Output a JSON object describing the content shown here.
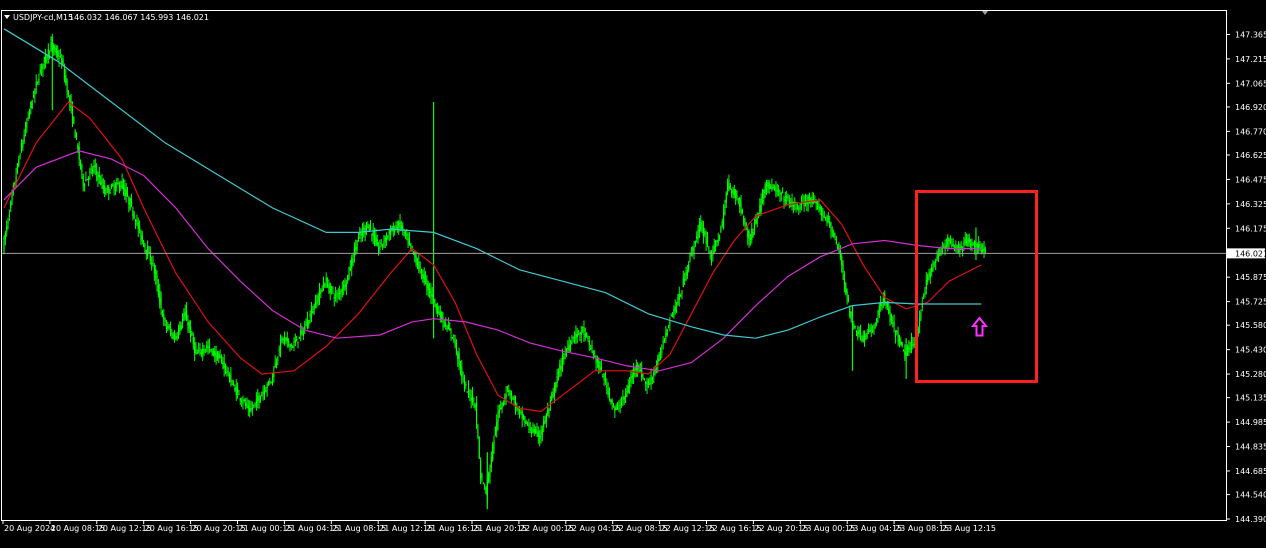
{
  "header": {
    "symbol": "USDJPY-cd,M15",
    "ohlc": "146.032 146.067 145.993 146.021"
  },
  "colors": {
    "background": "#000000",
    "frame": "#ffffff",
    "candle": "#00ff00",
    "ma_fast": "#e01010",
    "ma_medium": "#d030d0",
    "ma_slow": "#40c8d0",
    "price_line": "#a0a0a0",
    "highlight_box": "#ff2020",
    "arrow": "#ff30ff"
  },
  "chart_data": {
    "type": "line",
    "ylim": [
      144.39,
      147.46
    ],
    "current_price": 146.021,
    "current_price_label": "146.021",
    "y_ticks": [
      {
        "value": 147.365,
        "label": "147.365"
      },
      {
        "value": 147.215,
        "label": "147.215"
      },
      {
        "value": 147.065,
        "label": "147.065"
      },
      {
        "value": 146.92,
        "label": "146.920"
      },
      {
        "value": 146.77,
        "label": "146.770"
      },
      {
        "value": 146.625,
        "label": "146.625"
      },
      {
        "value": 146.475,
        "label": "146.475"
      },
      {
        "value": 146.325,
        "label": "146.325"
      },
      {
        "value": 146.175,
        "label": "146.175"
      },
      {
        "value": 145.875,
        "label": "145.875"
      },
      {
        "value": 145.725,
        "label": "145.725"
      },
      {
        "value": 145.58,
        "label": "145.580"
      },
      {
        "value": 145.43,
        "label": "145.430"
      },
      {
        "value": 145.28,
        "label": "145.280"
      },
      {
        "value": 145.135,
        "label": "145.135"
      },
      {
        "value": 144.985,
        "label": "144.985"
      },
      {
        "value": 144.835,
        "label": "144.835"
      },
      {
        "value": 144.685,
        "label": "144.685"
      },
      {
        "value": 144.54,
        "label": "144.540"
      },
      {
        "value": 144.39,
        "label": "144.390"
      }
    ],
    "x_labels": [
      "20 Aug 2024",
      "20 Aug 08:15",
      "20 Aug 12:15",
      "20 Aug 16:15",
      "20 Aug 20:15",
      "21 Aug 00:15",
      "21 Aug 04:15",
      "21 Aug 08:15",
      "21 Aug 12:15",
      "21 Aug 16:15",
      "21 Aug 20:15",
      "22 Aug 00:15",
      "22 Aug 04:15",
      "22 Aug 08:15",
      "22 Aug 12:15",
      "22 Aug 16:15",
      "22 Aug 20:15",
      "23 Aug 00:15",
      "23 Aug 04:15",
      "23 Aug 08:15",
      "23 Aug 12:15"
    ],
    "price_path": [
      [
        0,
        146.05
      ],
      [
        3,
        146.6
      ],
      [
        5,
        146.9
      ],
      [
        7,
        147.15
      ],
      [
        9,
        147.3
      ],
      [
        11,
        147.2
      ],
      [
        13,
        146.85
      ],
      [
        15,
        146.45
      ],
      [
        17,
        146.55
      ],
      [
        19,
        146.4
      ],
      [
        22,
        146.45
      ],
      [
        24,
        146.3
      ],
      [
        26,
        146.1
      ],
      [
        28,
        145.95
      ],
      [
        30,
        145.6
      ],
      [
        32,
        145.5
      ],
      [
        34,
        145.65
      ],
      [
        36,
        145.4
      ],
      [
        38,
        145.45
      ],
      [
        41,
        145.35
      ],
      [
        43,
        145.2
      ],
      [
        45,
        145.1
      ],
      [
        46,
        145.05
      ],
      [
        48,
        145.15
      ],
      [
        50,
        145.25
      ],
      [
        52,
        145.5
      ],
      [
        54,
        145.45
      ],
      [
        56,
        145.55
      ],
      [
        58,
        145.7
      ],
      [
        60,
        145.85
      ],
      [
        62,
        145.75
      ],
      [
        64,
        145.85
      ],
      [
        66,
        146.1
      ],
      [
        68,
        146.2
      ],
      [
        70,
        146.05
      ],
      [
        72,
        146.15
      ],
      [
        74,
        146.2
      ],
      [
        76,
        146.05
      ],
      [
        78,
        145.9
      ],
      [
        80,
        145.75
      ],
      [
        82,
        145.6
      ],
      [
        84,
        145.5
      ],
      [
        86,
        145.2
      ],
      [
        88,
        145.1
      ],
      [
        89,
        144.65
      ],
      [
        90,
        144.55
      ],
      [
        92,
        145.0
      ],
      [
        94,
        145.2
      ],
      [
        96,
        145.05
      ],
      [
        98,
        144.95
      ],
      [
        100,
        144.9
      ],
      [
        102,
        145.1
      ],
      [
        104,
        145.35
      ],
      [
        106,
        145.5
      ],
      [
        108,
        145.55
      ],
      [
        110,
        145.4
      ],
      [
        112,
        145.25
      ],
      [
        114,
        145.05
      ],
      [
        116,
        145.15
      ],
      [
        118,
        145.35
      ],
      [
        120,
        145.2
      ],
      [
        122,
        145.35
      ],
      [
        124,
        145.6
      ],
      [
        126,
        145.75
      ],
      [
        128,
        146.0
      ],
      [
        130,
        146.2
      ],
      [
        132,
        146.0
      ],
      [
        134,
        146.2
      ],
      [
        135,
        146.45
      ],
      [
        137,
        146.35
      ],
      [
        139,
        146.1
      ],
      [
        141,
        146.3
      ],
      [
        142,
        146.45
      ],
      [
        144,
        146.4
      ],
      [
        146,
        146.35
      ],
      [
        148,
        146.3
      ],
      [
        150,
        146.35
      ],
      [
        152,
        146.3
      ],
      [
        154,
        146.2
      ],
      [
        156,
        146.0
      ],
      [
        158,
        145.6
      ],
      [
        160,
        145.5
      ],
      [
        162,
        145.55
      ],
      [
        164,
        145.75
      ],
      [
        166,
        145.55
      ],
      [
        168,
        145.4
      ],
      [
        170,
        145.5
      ],
      [
        172,
        145.85
      ],
      [
        174,
        146.0
      ],
      [
        176,
        146.1
      ],
      [
        178,
        146.05
      ],
      [
        180,
        146.1
      ],
      [
        182,
        146.05
      ]
    ],
    "wick_spikes": [
      {
        "x": 80,
        "high": 146.95,
        "low": 145.5
      },
      {
        "x": 90,
        "high": 144.8,
        "low": 144.45
      },
      {
        "x": 9,
        "high": 147.35,
        "low": 146.9
      },
      {
        "x": 158,
        "high": 145.7,
        "low": 145.3
      },
      {
        "x": 168,
        "high": 145.5,
        "low": 145.25
      },
      {
        "x": 181,
        "high": 146.18,
        "low": 145.98
      }
    ],
    "series": [
      {
        "key": "ma_fast",
        "values": [
          [
            0,
            146.3
          ],
          [
            6,
            146.7
          ],
          [
            12,
            146.95
          ],
          [
            16,
            146.85
          ],
          [
            22,
            146.6
          ],
          [
            26,
            146.3
          ],
          [
            32,
            145.9
          ],
          [
            38,
            145.6
          ],
          [
            44,
            145.38
          ],
          [
            48,
            145.28
          ],
          [
            54,
            145.3
          ],
          [
            60,
            145.45
          ],
          [
            66,
            145.65
          ],
          [
            72,
            145.9
          ],
          [
            76,
            146.05
          ],
          [
            80,
            145.95
          ],
          [
            84,
            145.72
          ],
          [
            88,
            145.4
          ],
          [
            92,
            145.15
          ],
          [
            96,
            145.07
          ],
          [
            100,
            145.05
          ],
          [
            104,
            145.15
          ],
          [
            110,
            145.3
          ],
          [
            116,
            145.3
          ],
          [
            120,
            145.28
          ],
          [
            124,
            145.4
          ],
          [
            128,
            145.65
          ],
          [
            132,
            145.9
          ],
          [
            136,
            146.1
          ],
          [
            140,
            146.25
          ],
          [
            146,
            146.32
          ],
          [
            152,
            146.35
          ],
          [
            156,
            146.2
          ],
          [
            160,
            145.95
          ],
          [
            164,
            145.75
          ],
          [
            168,
            145.68
          ],
          [
            172,
            145.72
          ],
          [
            176,
            145.85
          ],
          [
            182,
            145.95
          ]
        ]
      },
      {
        "key": "ma_medium",
        "values": [
          [
            0,
            146.35
          ],
          [
            6,
            146.55
          ],
          [
            14,
            146.65
          ],
          [
            20,
            146.6
          ],
          [
            26,
            146.5
          ],
          [
            32,
            146.3
          ],
          [
            38,
            146.05
          ],
          [
            44,
            145.85
          ],
          [
            50,
            145.67
          ],
          [
            56,
            145.55
          ],
          [
            62,
            145.5
          ],
          [
            70,
            145.52
          ],
          [
            76,
            145.6
          ],
          [
            80,
            145.62
          ],
          [
            86,
            145.6
          ],
          [
            92,
            145.55
          ],
          [
            98,
            145.47
          ],
          [
            104,
            145.42
          ],
          [
            110,
            145.38
          ],
          [
            116,
            145.33
          ],
          [
            122,
            145.3
          ],
          [
            128,
            145.35
          ],
          [
            134,
            145.5
          ],
          [
            140,
            145.7
          ],
          [
            146,
            145.88
          ],
          [
            152,
            146.0
          ],
          [
            158,
            146.08
          ],
          [
            164,
            146.1
          ],
          [
            170,
            146.07
          ],
          [
            176,
            146.05
          ],
          [
            182,
            146.05
          ]
        ]
      },
      {
        "key": "ma_slow",
        "values": [
          [
            0,
            147.4
          ],
          [
            10,
            147.2
          ],
          [
            20,
            146.95
          ],
          [
            30,
            146.7
          ],
          [
            40,
            146.5
          ],
          [
            50,
            146.3
          ],
          [
            60,
            146.15
          ],
          [
            66,
            146.15
          ],
          [
            72,
            146.17
          ],
          [
            80,
            146.15
          ],
          [
            88,
            146.05
          ],
          [
            96,
            145.92
          ],
          [
            104,
            145.85
          ],
          [
            112,
            145.78
          ],
          [
            120,
            145.65
          ],
          [
            128,
            145.57
          ],
          [
            134,
            145.52
          ],
          [
            140,
            145.5
          ],
          [
            146,
            145.55
          ],
          [
            152,
            145.63
          ],
          [
            158,
            145.7
          ],
          [
            164,
            145.72
          ],
          [
            170,
            145.71
          ],
          [
            176,
            145.71
          ],
          [
            182,
            145.71
          ]
        ]
      }
    ]
  }
}
